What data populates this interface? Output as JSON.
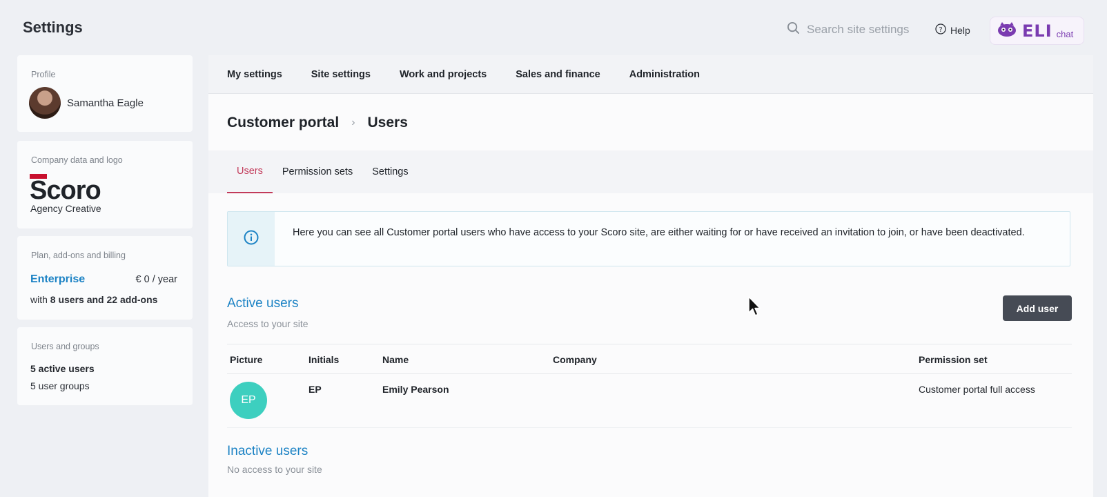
{
  "app": {
    "title": "Settings"
  },
  "header": {
    "search_placeholder": "Search site settings",
    "help_label": "Help",
    "eli": {
      "word": "ELI",
      "suffix": "chat"
    }
  },
  "sidebar": {
    "profile": {
      "label": "Profile",
      "name": "Samantha Eagle"
    },
    "company": {
      "label": "Company data and logo",
      "name": "Agency Creative"
    },
    "plan": {
      "label": "Plan, add-ons and billing",
      "name": "Enterprise",
      "price": "€ 0 / year",
      "with_prefix": "with ",
      "with_bold": "8 users and 22 add-ons"
    },
    "users": {
      "label": "Users and groups",
      "active": "5 active users",
      "groups": "5 user groups"
    }
  },
  "topnav": {
    "items": [
      "My settings",
      "Site settings",
      "Work and projects",
      "Sales and finance",
      "Administration"
    ]
  },
  "breadcrumb": {
    "parent": "Customer portal",
    "current": "Users"
  },
  "subtabs": {
    "items": [
      "Users",
      "Permission sets",
      "Settings"
    ],
    "active_index": 0
  },
  "info": {
    "text": "Here you can see all Customer portal users who have access to your Scoro site, are either waiting for or have received an invitation to join, or have been deactivated."
  },
  "active_users": {
    "title": "Active users",
    "subtitle": "Access to your site",
    "add_button": "Add user",
    "columns": [
      "Picture",
      "Initials",
      "Name",
      "Company",
      "Permission set"
    ],
    "rows": [
      {
        "avatar_text": "EP",
        "initials": "EP",
        "name": "Emily Pearson",
        "company": "",
        "permission_set": "Customer portal full access"
      }
    ]
  },
  "inactive_users": {
    "title": "Inactive users",
    "subtitle": "No access to your site"
  },
  "colors": {
    "accent_blue": "#1b82c4",
    "active_tab": "#c23a5a",
    "avatar_teal": "#3dcfbf",
    "button_dark": "#464b55"
  }
}
